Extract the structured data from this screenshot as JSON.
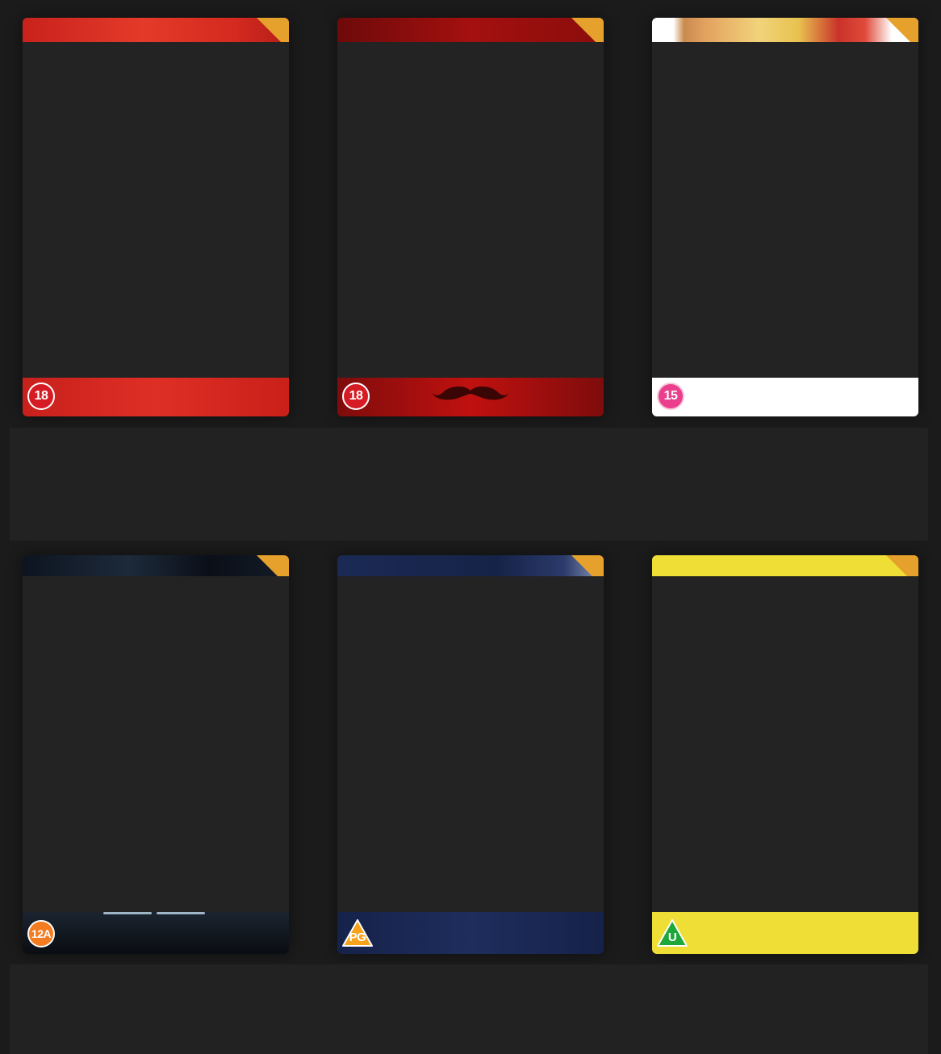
{
  "films": [
    {
      "rating": "18",
      "rating_color": "#d51c24",
      "badge_shape": "circle"
    },
    {
      "rating": "18",
      "rating_color": "#d51c24",
      "badge_shape": "circle"
    },
    {
      "rating": "15",
      "rating_color": "#ea3f8c",
      "badge_shape": "circle"
    },
    {
      "rating": "12A",
      "rating_color": "#f47c20",
      "badge_shape": "circle"
    },
    {
      "rating": "PG",
      "rating_color": "#f6a31b",
      "badge_shape": "triangle"
    },
    {
      "rating": "U",
      "rating_color": "#1ea83a",
      "badge_shape": "triangle"
    }
  ],
  "colors": {
    "background": "#1b1b1b",
    "band": "#222222",
    "card": "#232323",
    "corner_ribbon": "#e6a12c"
  }
}
